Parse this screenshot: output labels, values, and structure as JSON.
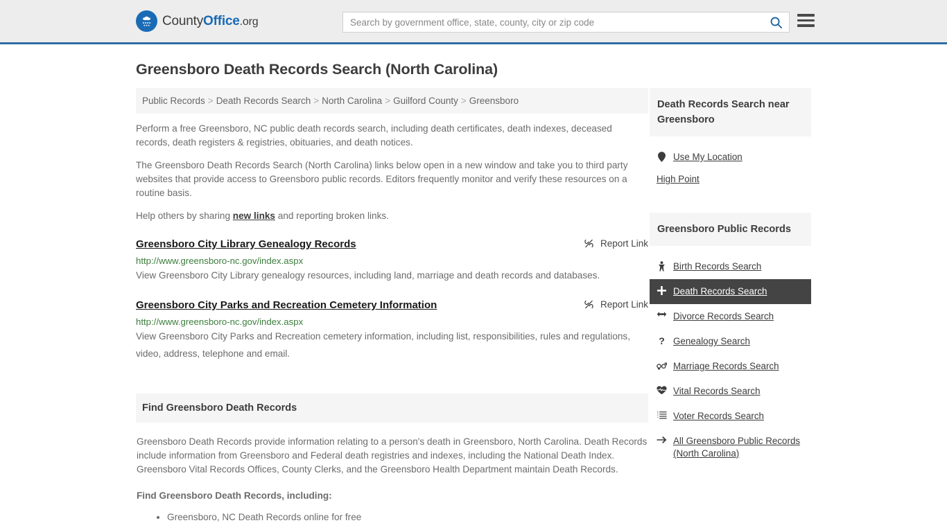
{
  "header": {
    "brand": {
      "part1": "County",
      "part2": "Office",
      "part3": ".org",
      "icon": "eagle-seal-icon"
    },
    "search": {
      "placeholder": "Search by government office, state, county, city or zip code",
      "value": "",
      "icon": "search-icon"
    },
    "menu_icon": "hamburger-menu-icon",
    "accent_color": "#2e6da4",
    "background": "#ededed"
  },
  "page": {
    "title": "Greensboro Death Records Search (North Carolina)"
  },
  "breadcrumb": {
    "separator": ">",
    "items": [
      "Public Records",
      "Death Records Search",
      "North Carolina",
      "Guilford County",
      "Greensboro"
    ]
  },
  "intro": {
    "p1": "Perform a free Greensboro, NC public death records search, including death certificates, death indexes, deceased records, death registers & registries, obituaries, and death notices.",
    "p2": "The Greensboro Death Records Search (North Carolina) links below open in a new window and take you to third party websites that provide access to Greensboro public records. Editors frequently monitor and verify these resources on a routine basis.",
    "p3_before": "Help others by sharing ",
    "p3_link": "new links",
    "p3_after": " and reporting broken links."
  },
  "results": [
    {
      "title": "Greensboro City Library Genealogy Records",
      "url": "http://www.greensboro-nc.gov/index.aspx",
      "description": "View Greensboro City Library genealogy resources, including land, marriage and death records and databases.",
      "report_label": "Report Link",
      "report_icon": "broken-link-icon"
    },
    {
      "title": "Greensboro City Parks and Recreation Cemetery Information",
      "url": "http://www.greensboro-nc.gov/index.aspx",
      "description": "View Greensboro City Parks and Recreation cemetery information, including list, responsibilities, rules and regulations, video, address, telephone and email.",
      "report_label": "Report Link",
      "report_icon": "broken-link-icon"
    }
  ],
  "find_panel": {
    "heading": "Find Greensboro Death Records",
    "body": "Greensboro Death Records provide information relating to a person's death in Greensboro, North Carolina. Death Records include information from Greensboro and Federal death registries and indexes, including the National Death Index. Greensboro Vital Records Offices, County Clerks, and the Greensboro Health Department maintain Death Records.",
    "subheading": "Find Greensboro Death Records, including:",
    "items": [
      "Greensboro, NC Death Records online for free"
    ]
  },
  "sidebar": {
    "near": {
      "heading": "Death Records Search near Greensboro",
      "use_location": {
        "label": "Use My Location",
        "icon": "map-pin-icon"
      },
      "cities": [
        "High Point"
      ]
    },
    "public_records": {
      "heading": "Greensboro Public Records",
      "items": [
        {
          "label": "Birth Records Search",
          "icon": "baby-icon",
          "glyph": "Ɣ",
          "active": false
        },
        {
          "label": "Death Records Search",
          "icon": "cross-plus-icon",
          "glyph": "✚",
          "active": true
        },
        {
          "label": "Divorce Records Search",
          "icon": "left-right-arrow-icon",
          "glyph": "↔",
          "active": false
        },
        {
          "label": "Genealogy Search",
          "icon": "question-mark-icon",
          "glyph": "?",
          "active": false
        },
        {
          "label": "Marriage Records Search",
          "icon": "male-female-icon",
          "glyph": "⚥",
          "active": false
        },
        {
          "label": "Vital Records Search",
          "icon": "heartbeat-icon",
          "glyph": "❤",
          "active": false
        },
        {
          "label": "Voter Records Search",
          "icon": "ordered-list-icon",
          "glyph": "≣",
          "active": false
        },
        {
          "label": "All Greensboro Public Records (North Carolina)",
          "icon": "arrow-right-icon",
          "glyph": "→",
          "active": false
        }
      ]
    }
  },
  "colors": {
    "brand_blue": "#1a6bb5",
    "header_border": "#2e6da4",
    "panel_gray": "#f5f5f5",
    "active_bg": "#444444",
    "url_green": "#3c7d3c",
    "body_text": "#6b6b6b"
  }
}
